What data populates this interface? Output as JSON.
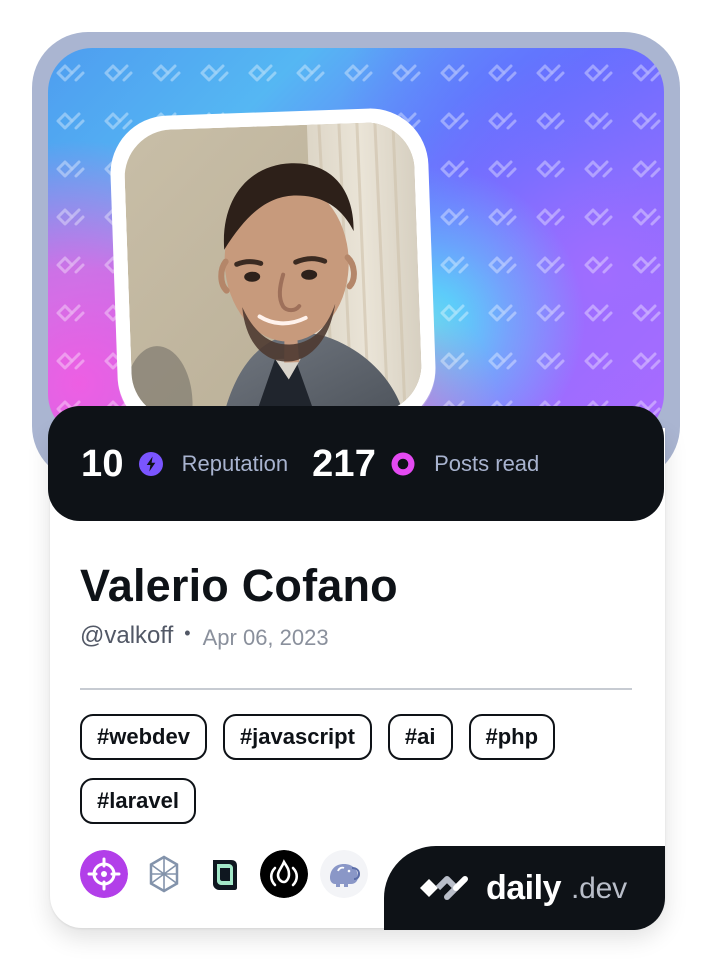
{
  "profile": {
    "name": "Valerio Cofano",
    "handle": "@valkoff",
    "joined": "Apr 06, 2023"
  },
  "stats": {
    "reputation_value": "10",
    "reputation_label": "Reputation",
    "posts_value": "217",
    "posts_label": "Posts read"
  },
  "tags": [
    "#webdev",
    "#javascript",
    "#ai",
    "#php",
    "#laravel"
  ],
  "stack_icons": [
    "target-icon",
    "hexagon-icon",
    "book-icon",
    "fire-icon",
    "elephant-icon"
  ],
  "brand": {
    "word": "daily",
    "domain": ".dev"
  },
  "icons": {
    "reputation": "lightning-icon",
    "posts": "ring-icon",
    "divider_dot": "dot-icon",
    "brand": "daily-dev-logo-icon"
  },
  "colors": {
    "background": "#ffffff",
    "frame": "#aab5d1",
    "panel_dark": "#0e1217",
    "reputation_accent": "#7a55ff",
    "posts_accent": "#e44af2",
    "text_primary": "#0e1217",
    "text_secondary": "#525866",
    "text_muted": "#8a909c",
    "divider": "#c7cbd2"
  }
}
